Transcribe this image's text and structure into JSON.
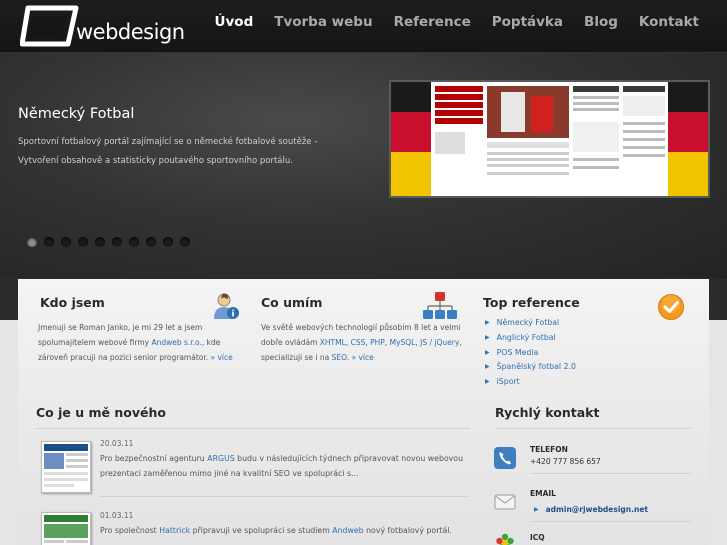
{
  "logo": {
    "text": "webdesign"
  },
  "nav": [
    "Úvod",
    "Tvorba webu",
    "Reference",
    "Poptávka",
    "Blog",
    "Kontakt"
  ],
  "slide": {
    "title": "Německý Fotbal",
    "text": "Sportovní fotbalový portál zajímající se o německé fotbalové soutěže - Vytvoření obsahově a statisticky poutavého sportovního portálu.",
    "dot_count": 10,
    "active_dot": 1
  },
  "kdo": {
    "title": "Kdo jsem",
    "t1": "Jmenuji se Roman Janko, je mi 29 let a jsem spolumajitelem webové firmy ",
    "link1": "Andweb s.r.o.",
    "t2": ", kde zároveň pracuji na pozici senior programátor. ",
    "more": "» více"
  },
  "umim": {
    "title": "Co umím",
    "t1": "Ve světě webových technologií působím 8 let a velmi dobře ovládám ",
    "l1": "XHTML",
    "c1": ", ",
    "l2": "CSS",
    "c2": ", ",
    "l3": "PHP",
    "c3": ", ",
    "l4": "MySQL",
    "c4": ", ",
    "l5": "JS / jQuery",
    "t2": ", specializuji se i na ",
    "l6": "SEO",
    "t3": ". ",
    "more": "» více"
  },
  "top": {
    "title": "Top reference",
    "items": [
      "Německý Fotbal",
      "Anglický Fotbal",
      "POS Media",
      "Španělský fotbal 2.0",
      "iSport"
    ]
  },
  "news": {
    "title": "Co je u mě nového",
    "items": [
      {
        "date": "20.03.11",
        "t1": "Pro bezpečnostní agenturu ",
        "l1": "ARGUS",
        "t2": " budu v následujících týdnech připravovat novou webovou prezentaci zaměřenou mimo jiné na kvalitní SEO ve spolupráci s..."
      },
      {
        "date": "01.03.11",
        "t1": "Pro společnost ",
        "l1": "Hattrick",
        "t2": " připravuji ve spolupráci se studiem ",
        "l2": "Andweb",
        "t3": " nový fotbalový portál."
      }
    ]
  },
  "contact": {
    "title": "Rychlý kontakt",
    "phone_label": "TELEFON",
    "phone": "+420 777 856 657",
    "email_label": "EMAIL",
    "email": "admin@rjwebdesign.net",
    "icq_label": "ICQ"
  }
}
